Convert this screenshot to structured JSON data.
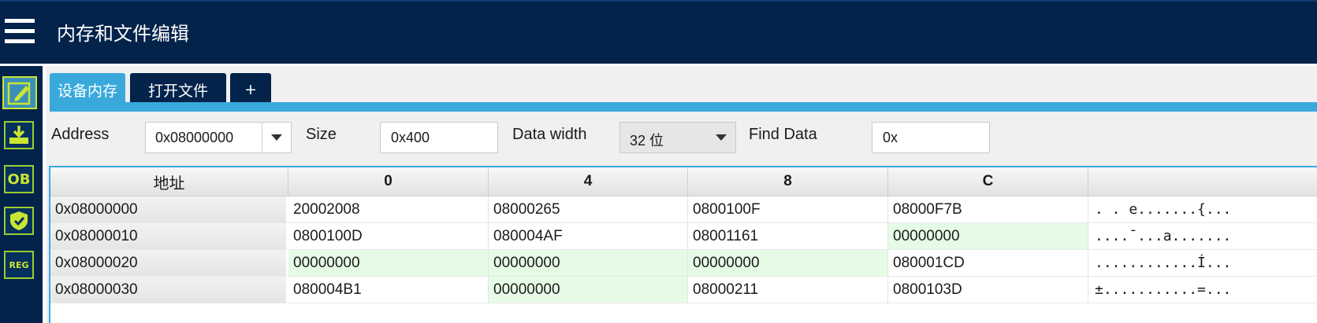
{
  "app": {
    "title": "内存和文件编辑"
  },
  "sidebar": {
    "items": [
      {
        "name": "memory-edit",
        "icon": "edit-icon",
        "active": true
      },
      {
        "name": "download",
        "icon": "download-icon",
        "active": false
      },
      {
        "name": "option-bytes",
        "icon": "ob-icon",
        "label": "OB",
        "active": false
      },
      {
        "name": "security",
        "icon": "shield-icon",
        "active": false
      },
      {
        "name": "registers",
        "icon": "reg-icon",
        "label": "REG",
        "active": false
      }
    ]
  },
  "tabs": [
    {
      "label": "设备内存",
      "active": true
    },
    {
      "label": "打开文件",
      "active": false
    },
    {
      "label": "+",
      "active": false
    }
  ],
  "toolbar": {
    "address_label": "Address",
    "address_value": "0x08000000",
    "size_label": "Size",
    "size_value": "0x400",
    "data_width_label": "Data width",
    "data_width_value": "32 位",
    "find_label": "Find Data",
    "find_value": "0x"
  },
  "table": {
    "headers": [
      "地址",
      "0",
      "4",
      "8",
      "C",
      ""
    ],
    "rows": [
      {
        "address": "0x08000000",
        "cells": [
          "20002008",
          "08000265",
          "0800100F",
          "08000F7B"
        ],
        "ascii": ". . e.......{..."
      },
      {
        "address": "0x08000010",
        "cells": [
          "0800100D",
          "080004AF",
          "08001161",
          "00000000"
        ],
        "ascii": "....¯...a......."
      },
      {
        "address": "0x08000020",
        "cells": [
          "00000000",
          "00000000",
          "00000000",
          "080001CD"
        ],
        "ascii": "............Í..."
      },
      {
        "address": "0x08000030",
        "cells": [
          "080004B1",
          "00000000",
          "08000211",
          "0800103D"
        ],
        "ascii": "±...........=..."
      }
    ]
  },
  "colors": {
    "header_bg": "#03234b",
    "accent_blue": "#39a9dc",
    "sidebar_icon": "#c8e632",
    "zero_cell_bg": "#e6fbe6"
  }
}
